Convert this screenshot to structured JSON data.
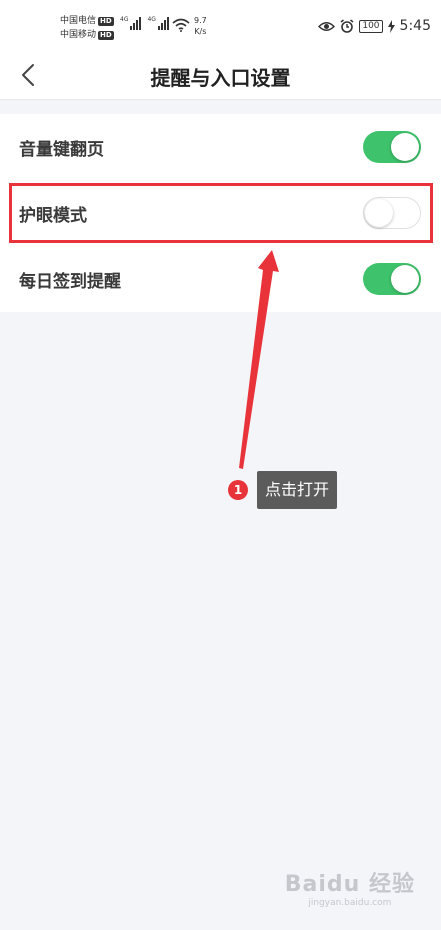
{
  "status_bar": {
    "carrier1": "中国电信",
    "carrier2": "中国移动",
    "hd": "HD",
    "network_gen": "4G",
    "speed_value": "9.7",
    "speed_unit": "K/s",
    "battery": "100",
    "time": "5:45",
    "icons": [
      "eye-icon",
      "alarm-icon",
      "charging-icon",
      "wifi-icon",
      "signal-icon"
    ]
  },
  "header": {
    "title": "提醒与入口设置",
    "back_icon": "chevron-left-icon"
  },
  "settings": [
    {
      "label": "音量键翻页",
      "enabled": true
    },
    {
      "label": "护眼模式",
      "enabled": false
    },
    {
      "label": "每日签到提醒",
      "enabled": true
    }
  ],
  "annotation": {
    "step_number": "1",
    "tip_text": "点击打开",
    "color": "#e8333a"
  },
  "watermark": {
    "main": "Baidu 经验",
    "sub": "jingyan.baidu.com"
  },
  "colors": {
    "toggle_on": "#3ec26b",
    "background": "#f4f5f9",
    "highlight": "#e8333a"
  }
}
